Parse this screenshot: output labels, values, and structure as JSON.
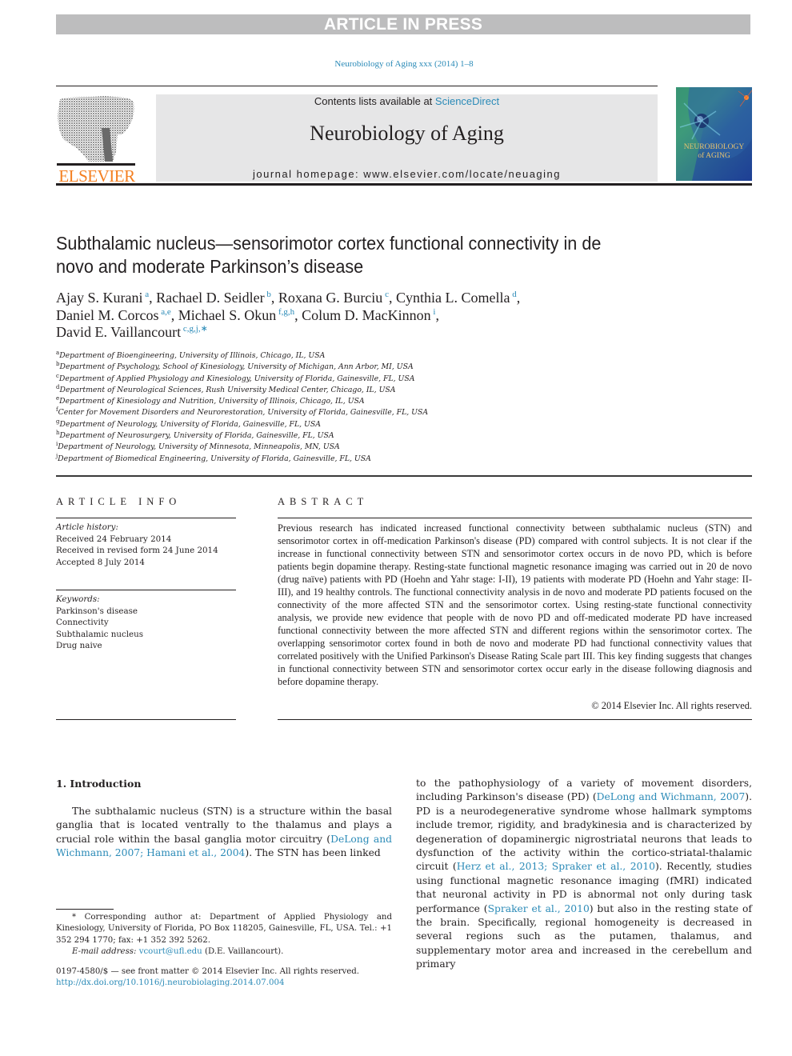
{
  "banner": "ARTICLE IN PRESS",
  "citation": "Neurobiology of Aging xxx (2014) 1–8",
  "publisher": {
    "logo_text": "ELSEVIER",
    "logo_color": "#f47f20"
  },
  "masthead": {
    "contents_prefix": "Contents lists available at ",
    "contents_link": "ScienceDirect",
    "journal_title": "Neurobiology of Aging",
    "homepage_prefix": "journal homepage: ",
    "homepage_url": "www.elsevier.com/locate/neuaging"
  },
  "cover": {
    "title_line1": "NEUROBIOLOGY",
    "title_line2": "of AGING"
  },
  "article": {
    "title": "Subthalamic nucleus—sensorimotor cortex functional connectivity in de novo and moderate Parkinson’s disease",
    "authors": [
      {
        "name": "Ajay S. Kurani",
        "aff": "a",
        "sep": ", "
      },
      {
        "name": "Rachael D. Seidler",
        "aff": "b",
        "sep": ", "
      },
      {
        "name": "Roxana G. Burciu",
        "aff": "c",
        "sep": ", "
      },
      {
        "name": "Cynthia L. Comella",
        "aff": "d",
        "sep": ","
      },
      {
        "name": "Daniel M. Corcos",
        "aff": "a,e",
        "sep": ", "
      },
      {
        "name": "Michael S. Okun",
        "aff": "f,g,h",
        "sep": ", "
      },
      {
        "name": "Colum D. MacKinnon",
        "aff": "i",
        "sep": ","
      },
      {
        "name": "David E. Vaillancourt",
        "aff": "c,g,j,∗",
        "sep": ""
      }
    ],
    "affiliations": [
      {
        "key": "a",
        "text": "Department of Bioengineering, University of Illinois, Chicago, IL, USA"
      },
      {
        "key": "b",
        "text": "Department of Psychology, School of Kinesiology, University of Michigan, Ann Arbor, MI, USA"
      },
      {
        "key": "c",
        "text": "Department of Applied Physiology and Kinesiology, University of Florida, Gainesville, FL, USA"
      },
      {
        "key": "d",
        "text": "Department of Neurological Sciences, Rush University Medical Center, Chicago, IL, USA"
      },
      {
        "key": "e",
        "text": "Department of Kinesiology and Nutrition, University of Illinois, Chicago, IL, USA"
      },
      {
        "key": "f",
        "text": "Center for Movement Disorders and Neurorestoration, University of Florida, Gainesville, FL, USA"
      },
      {
        "key": "g",
        "text": "Department of Neurology, University of Florida, Gainesville, FL, USA"
      },
      {
        "key": "h",
        "text": "Department of Neurosurgery, University of Florida, Gainesville, FL, USA"
      },
      {
        "key": "i",
        "text": "Department of Neurology, University of Minnesota, Minneapolis, MN, USA"
      },
      {
        "key": "j",
        "text": "Department of Biomedical Engineering, University of Florida, Gainesville, FL, USA"
      }
    ]
  },
  "article_info": {
    "heading": "ARTICLE INFO",
    "history_label": "Article history:",
    "history": [
      "Received 24 February 2014",
      "Received in revised form 24 June 2014",
      "Accepted 8 July 2014"
    ],
    "keywords_label": "Keywords:",
    "keywords": [
      "Parkinson's disease",
      "Connectivity",
      "Subthalamic nucleus",
      "Drug naive"
    ]
  },
  "abstract": {
    "heading": "ABSTRACT",
    "text": "Previous research has indicated increased functional connectivity between subthalamic nucleus (STN) and sensorimotor cortex in off-medication Parkinson's disease (PD) compared with control subjects. It is not clear if the increase in functional connectivity between STN and sensorimotor cortex occurs in de novo PD, which is before patients begin dopamine therapy. Resting-state functional magnetic resonance imaging was carried out in 20 de novo (drug naïve) patients with PD (Hoehn and Yahr stage: I-II), 19 patients with moderate PD (Hoehn and Yahr stage: II-III), and 19 healthy controls. The functional connectivity analysis in de novo and moderate PD patients focused on the connectivity of the more affected STN and the sensorimotor cortex. Using resting-state functional connectivity analysis, we provide new evidence that people with de novo PD and off-medicated moderate PD have increased functional connectivity between the more affected STN and different regions within the sensorimotor cortex. The overlapping sensorimotor cortex found in both de novo and moderate PD had functional connectivity values that correlated positively with the Unified Parkinson's Disease Rating Scale part III. This key finding suggests that changes in functional connectivity between STN and sensorimotor cortex occur early in the disease following diagnosis and before dopamine therapy.",
    "copyright": "© 2014 Elsevier Inc. All rights reserved."
  },
  "introduction": {
    "heading": "1.  Introduction",
    "p1_a": "The subthalamic nucleus (STN) is a structure within the basal ganglia that is located ventrally to the thalamus and plays a crucial role within the basal ganglia motor circuitry (",
    "p1_link": "DeLong and Wichmann, 2007; Hamani et al., 2004",
    "p1_b": "). The STN has been linked",
    "c2_a": "to the pathophysiology of a variety of movement disorders, including Parkinson's disease (PD) (",
    "c2_link1": "DeLong and Wichmann, 2007",
    "c2_b": "). PD is a neurodegenerative syndrome whose hallmark symptoms include tremor, rigidity, and bradykinesia and is characterized by degeneration of dopaminergic nigrostriatal neurons that leads to dysfunction of the activity within the cortico-striatal-thalamic circuit (",
    "c2_link2": "Herz et al., 2013; Spraker et al., 2010",
    "c2_c": "). Recently, studies using functional magnetic resonance imaging (fMRI) indicated that neuronal activity in PD is abnormal not only during task performance (",
    "c2_link3": "Spraker et al., 2010",
    "c2_d": ") but also in the resting state of the brain. Specifically, regional homogeneity is decreased in several regions such as the putamen, thalamus, and supplementary motor area and increased in the cerebellum and primary"
  },
  "footnote": {
    "corresponding": "* Corresponding author at: Department of Applied Physiology and Kinesiology, University of Florida, PO Box 118205, Gainesville, FL, USA. Tel.: +1 352 294 1770; fax: +1 352 392 5262.",
    "email_label": "E-mail address:",
    "email": "vcourt@ufl.edu",
    "email_suffix": " (D.E. Vaillancourt).",
    "front_matter": "0197-4580/$ — see front matter © 2014 Elsevier Inc. All rights reserved.",
    "doi": "http://dx.doi.org/10.1016/j.neurobiolaging.2014.07.004"
  },
  "colors": {
    "link": "#2a8ab7",
    "banner_bg": "#bdbdbe",
    "masthead_bg": "#e6e6e7"
  }
}
